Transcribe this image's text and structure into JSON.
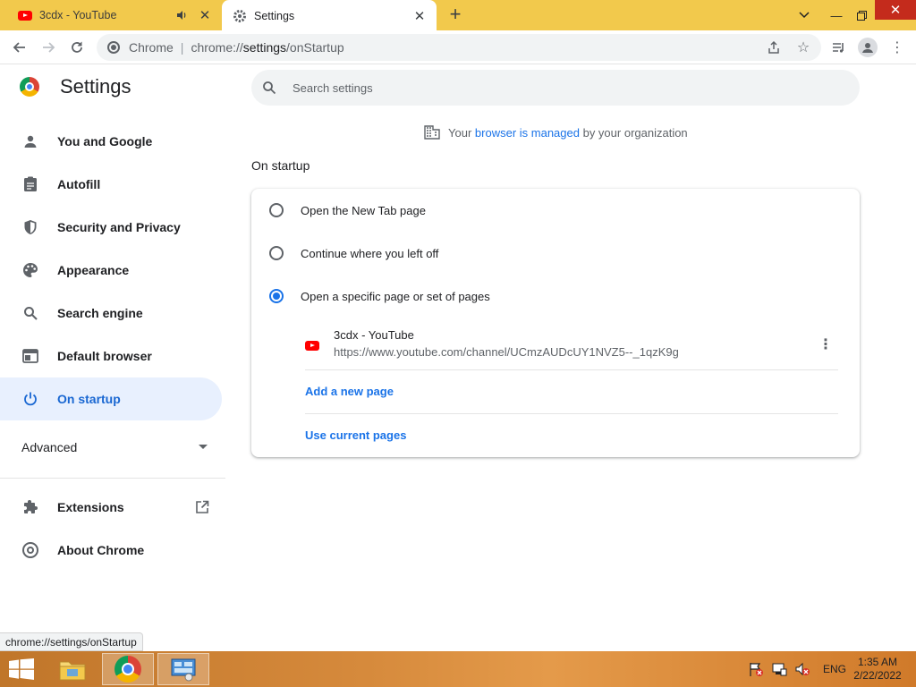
{
  "tabs": [
    {
      "title": "3cdx - YouTube",
      "icon": "youtube-icon"
    },
    {
      "title": "Settings",
      "icon": "gear-icon"
    }
  ],
  "toolbar": {
    "site_label": "Chrome",
    "url_prefix": "chrome://",
    "url_host": "settings",
    "url_path": "/onStartup"
  },
  "sidebar": {
    "title": "Settings",
    "items": [
      {
        "label": "You and Google",
        "icon": "person-icon"
      },
      {
        "label": "Autofill",
        "icon": "clipboard-icon"
      },
      {
        "label": "Security and Privacy",
        "icon": "shield-icon"
      },
      {
        "label": "Appearance",
        "icon": "palette-icon"
      },
      {
        "label": "Search engine",
        "icon": "search-icon"
      },
      {
        "label": "Default browser",
        "icon": "browser-icon"
      },
      {
        "label": "On startup",
        "icon": "power-icon"
      }
    ],
    "advanced_label": "Advanced",
    "extensions_label": "Extensions",
    "about_label": "About Chrome"
  },
  "search": {
    "placeholder": "Search settings"
  },
  "managed": {
    "before": "Your ",
    "link": "browser is managed",
    "after": " by your organization"
  },
  "main": {
    "section_title": "On startup",
    "options": [
      {
        "label": "Open the New Tab page",
        "checked": false
      },
      {
        "label": "Continue where you left off",
        "checked": false
      },
      {
        "label": "Open a specific page or set of pages",
        "checked": true
      }
    ],
    "page_entry": {
      "name": "3cdx - YouTube",
      "url": "https://www.youtube.com/channel/UCmzAUDcUY1NVZ5--_1qzK9g"
    },
    "add_page_label": "Add a new page",
    "use_current_label": "Use current pages"
  },
  "status_bubble": "chrome://settings/onStartup",
  "taskbar": {
    "language": "ENG",
    "time": "1:35 AM",
    "date": "2/22/2022"
  },
  "colors": {
    "tabstrip": "#f2c94c",
    "accent": "#1a73e8",
    "active_nav_bg": "#e8f0fe"
  }
}
